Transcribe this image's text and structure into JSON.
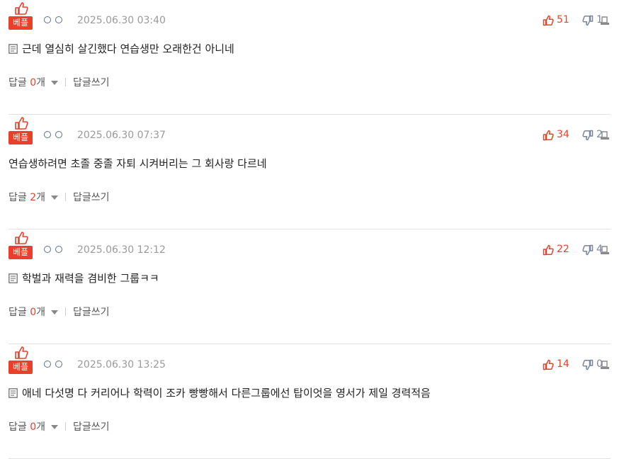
{
  "comments": [
    {
      "badge": "베플",
      "date": "2025.06.30 03:40",
      "up": "51",
      "down": "1",
      "has_memo": true,
      "text": "근데 열심히 살긴했다 연습생만 오래한건 아니네",
      "reply_prefix": "답글 ",
      "reply_count": "0",
      "reply_suffix": "개",
      "write_label": "답글쓰기"
    },
    {
      "badge": "베플",
      "date": "2025.06.30 07:37",
      "up": "34",
      "down": "2",
      "has_memo": false,
      "text": "연습생하려면 초졸 중졸 자퇴 시켜버리는 그 회사랑 다르네",
      "reply_prefix": "답글 ",
      "reply_count": "2",
      "reply_suffix": "개",
      "write_label": "답글쓰기"
    },
    {
      "badge": "베플",
      "date": "2025.06.30 12:12",
      "up": "22",
      "down": "4",
      "has_memo": true,
      "text": "학벌과 재력을 겸비한 그룹ㅋㅋ",
      "reply_prefix": "답글 ",
      "reply_count": "0",
      "reply_suffix": "개",
      "write_label": "답글쓰기"
    },
    {
      "badge": "베플",
      "date": "2025.06.30 13:25",
      "up": "14",
      "down": "0",
      "has_memo": true,
      "text": "애네 다섯명 다 커리어나 학력이 조카 빵빵해서 다른그룹에선 탑이엇을 영서가 제일 경력적음",
      "reply_prefix": "답글 ",
      "reply_count": "0",
      "reply_suffix": "개",
      "write_label": "답글쓰기"
    }
  ],
  "colors": {
    "accent": "#e8402b",
    "muted": "#9a9a9a",
    "ring": "#5a6f93",
    "down": "#7a8697"
  },
  "icons": {
    "best": "thumbs-up-best-icon",
    "up": "thumbs-up-icon",
    "down": "thumbs-down-icon",
    "report": "report-icon",
    "memo": "memo-icon",
    "author": "author-rings-icon",
    "arrow": "caret-down-icon"
  }
}
